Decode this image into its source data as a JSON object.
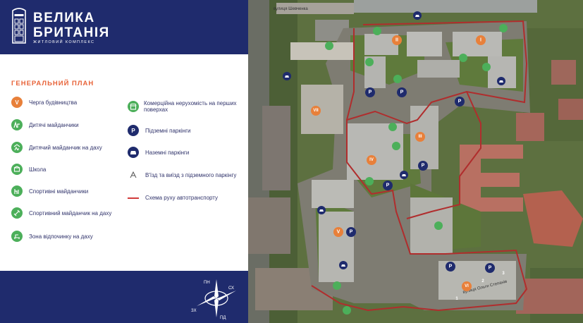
{
  "brand": {
    "title_line1": "ВЕЛИКА",
    "title_line2": "БРИТАНІЯ",
    "subtitle": "ЖИТЛОВИЙ КОМПЛЕКС",
    "logo_icon": "phone-booth-icon"
  },
  "legend": {
    "title": "ГЕНЕРАЛЬНИЙ ПЛАН",
    "col1": [
      {
        "label": "Черга будівництва",
        "icon": "V",
        "color": "#e8803a"
      },
      {
        "label": "Дитячі майданчики",
        "icon": "playground-icon",
        "color": "#4caf5a"
      },
      {
        "label": "Дитячий майданчик на даху",
        "icon": "roof-playground-icon",
        "color": "#4caf5a"
      },
      {
        "label": "Школа",
        "icon": "school-icon",
        "color": "#4caf5a"
      },
      {
        "label": "Спортивні майданчики",
        "icon": "sport-icon",
        "color": "#4caf5a"
      },
      {
        "label": "Спортивний майданчик на даху",
        "icon": "roof-sport-icon",
        "color": "#4caf5a"
      },
      {
        "label": "Зона відпочинку на даху",
        "icon": "roof-rest-icon",
        "color": "#4caf5a"
      }
    ],
    "col2": [
      {
        "label": "Комерційна нерухомість на перших поверхах",
        "icon": "commercial-icon",
        "color": "#4caf5a"
      },
      {
        "label": "Підземні паркінги",
        "icon": "P",
        "color": "#1f2b6d"
      },
      {
        "label": "Наземні паркінги",
        "icon": "car-icon",
        "color": "#1f2b6d"
      },
      {
        "label": "В'їзд та виїзд з підземного паркінгу",
        "icon": "entry-arrows-icon",
        "color": "#444444"
      },
      {
        "label": "Схема руху автотранспорту",
        "icon": "route-line",
        "color": "#d23b3b"
      }
    ]
  },
  "compass": {
    "n": "ПН",
    "s": "ПД",
    "e": "СХ",
    "w": "ЗХ"
  },
  "map": {
    "streets": {
      "top": "вулиця Шевченка",
      "bottom": "вулиця Ольги Степанів"
    },
    "queue_markers": [
      "II",
      "I",
      "VII",
      "III",
      "IV",
      "V",
      "VI"
    ],
    "section_numbers": [
      "1",
      "2",
      "3"
    ],
    "parking_label": "P"
  }
}
